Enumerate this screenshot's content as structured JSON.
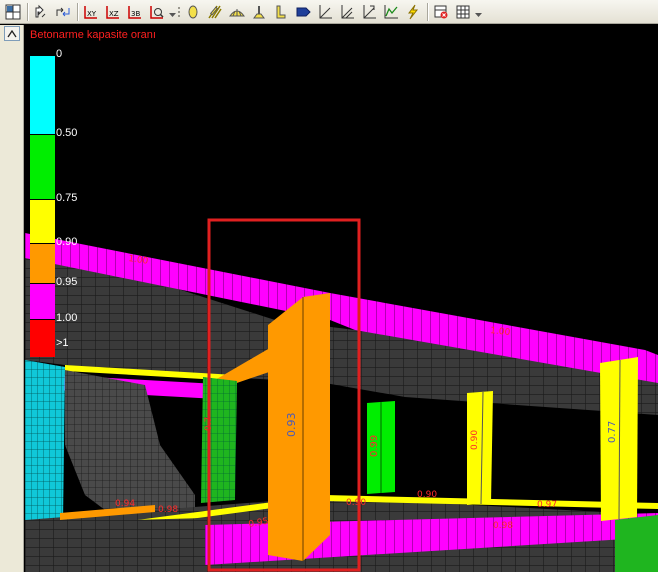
{
  "toolbar": {
    "groups": [
      [
        "window-layout-icon"
      ],
      [
        "pointer-icon",
        "rotate-view-icon"
      ],
      [
        "view-xy-icon",
        "view-xz-icon",
        "view-3d-icon",
        "zoom-fit-icon"
      ],
      [
        "column-icon",
        "beam-icon",
        "slab-icon",
        "foundation-icon",
        "wall-icon",
        "tag-icon",
        "axis-icon",
        "axis-split-icon",
        "axis-load-icon",
        "graph-icon",
        "lightning-icon"
      ],
      [
        "delete-view-icon",
        "grid-icon"
      ]
    ]
  },
  "legend": {
    "title": "Betonarme kapasite oranı",
    "segments": [
      {
        "color": "#00ffff",
        "label": "0",
        "value": 0
      },
      {
        "color": "#00ee00",
        "label": "0.50",
        "value": 0.5
      },
      {
        "color": "#ffff00",
        "label": "0.75",
        "value": 0.75
      },
      {
        "color": "#ff9900",
        "label": "0.90",
        "value": 0.9
      },
      {
        "color": "#ff00ff",
        "label": "0.95",
        "value": 0.95
      },
      {
        "color": "#ff0000",
        "label": "1.00",
        "value": 1.0
      }
    ],
    "overflow_label": ">1"
  },
  "model_labels": [
    {
      "text": "1.00",
      "color": "#ff2a2a"
    },
    {
      "text": "1.00",
      "color": "#ff2a2a"
    },
    {
      "text": "0.93",
      "color": "#4a5ab8"
    },
    {
      "text": "0.99",
      "color": "#ff2a2a"
    },
    {
      "text": "0.90",
      "color": "#ff2a2a"
    },
    {
      "text": "0.77",
      "color": "#4a5ab8"
    },
    {
      "text": "0.94",
      "color": "#ff2a2a"
    },
    {
      "text": "0.98",
      "color": "#ff2a2a"
    },
    {
      "text": "0.95",
      "color": "#ff2a2a"
    },
    {
      "text": "0.90",
      "color": "#ff2a2a"
    },
    {
      "text": "0.90",
      "color": "#ff2a2a"
    },
    {
      "text": "0.97",
      "color": "#ff2a2a"
    },
    {
      "text": "0.98",
      "color": "#ff2a2a"
    },
    {
      "text": "0.7",
      "color": "#ff2a2a"
    }
  ],
  "highlight": {
    "color": "#e02020"
  }
}
